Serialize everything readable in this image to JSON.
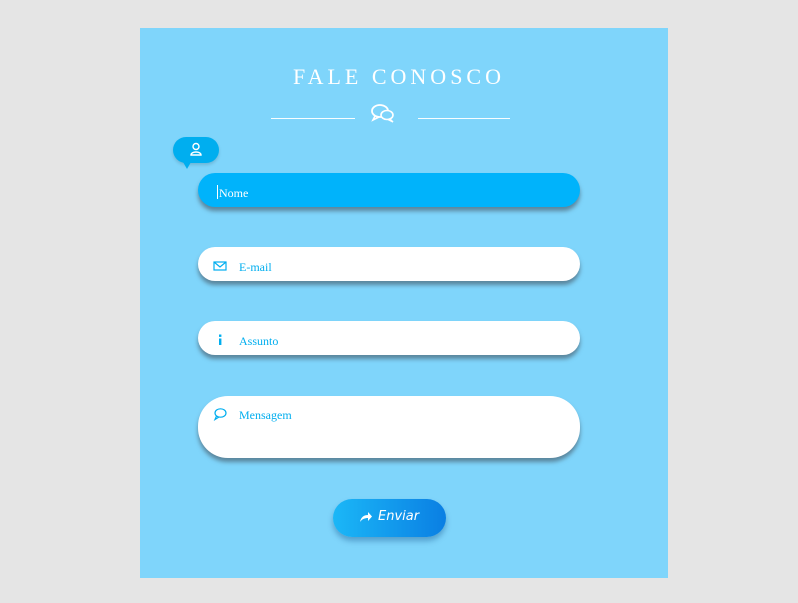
{
  "form": {
    "title": "FALE CONOSCO",
    "fields": {
      "name_label": "Nome",
      "email_label": "E-mail",
      "subject_label": "Assunto",
      "message_label": "Mensagem"
    },
    "submit_label": "Enviar"
  },
  "icons": {
    "header": "chat-bubbles-icon",
    "name": "user-icon",
    "email": "envelope-icon",
    "subject": "info-icon",
    "message": "speech-bubble-icon",
    "submit": "share-arrow-icon"
  },
  "colors": {
    "page_background": "#e5e5e5",
    "panel_background": "#7fd5fb",
    "accent": "#00aeef",
    "active_field": "#00b3fb",
    "button_gradient_start": "#1bb7f7",
    "button_gradient_end": "#0a7fe3"
  }
}
